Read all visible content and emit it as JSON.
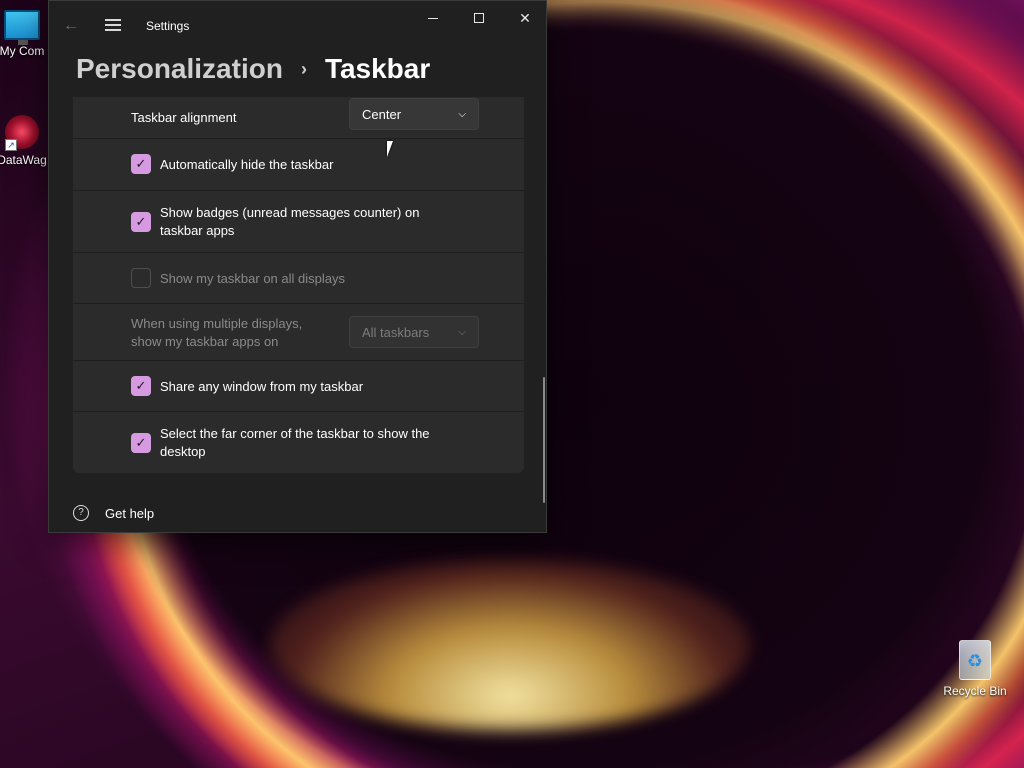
{
  "desktop": {
    "icons": [
      {
        "label": "My Com",
        "icon": "computer-icon"
      },
      {
        "label": "DataWag",
        "icon": "datawagon-icon"
      },
      {
        "label": "Recycle Bin",
        "icon": "recycle-bin-icon"
      }
    ]
  },
  "window": {
    "app_title": "Settings",
    "breadcrumb": {
      "parent": "Personalization",
      "separator": "›",
      "current": "Taskbar"
    },
    "rows": [
      {
        "label": "Taskbar alignment",
        "type": "dropdown",
        "value": "Center"
      },
      {
        "label": "Automatically hide the taskbar",
        "type": "checkbox",
        "checked": true
      },
      {
        "label_line1": "Show badges (unread messages counter) on",
        "label_line2": "taskbar apps",
        "type": "checkbox",
        "checked": true
      },
      {
        "label": "Show my taskbar on all displays",
        "type": "checkbox",
        "checked": false,
        "disabled": true
      },
      {
        "label_line1": "When using multiple displays,",
        "label_line2": "show my taskbar apps on",
        "type": "dropdown",
        "value": "All taskbars",
        "disabled": true
      },
      {
        "label": "Share any window from my taskbar",
        "type": "checkbox",
        "checked": true
      },
      {
        "label_line1": "Select the far corner of the taskbar to show the",
        "label_line2": "desktop",
        "type": "checkbox",
        "checked": true
      }
    ],
    "help_label": "Get help"
  },
  "colors": {
    "accent_checkbox": "#d59adf",
    "window_bg": "#202020",
    "card_bg": "#2b2b2b"
  }
}
